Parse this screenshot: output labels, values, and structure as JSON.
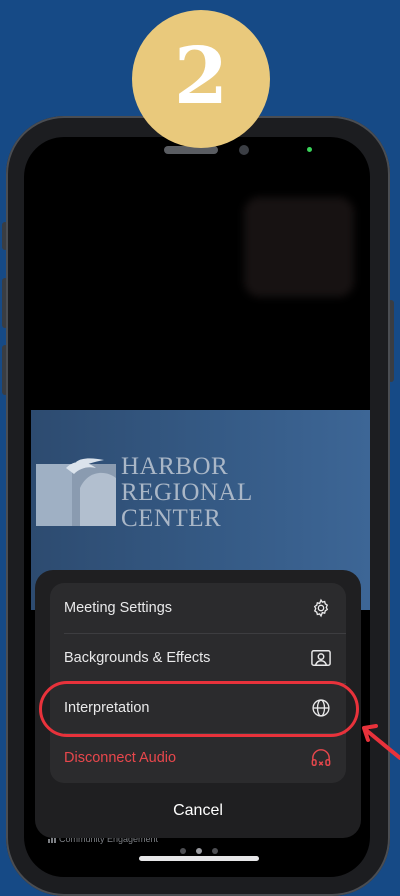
{
  "step": {
    "number": "2"
  },
  "background": {
    "brand": "Harbor Regional Center",
    "name_lines": [
      "HARBOR",
      "REGIONAL",
      "CENTER"
    ]
  },
  "video_footer": {
    "label": "Community Engagement"
  },
  "menu": {
    "items": [
      {
        "label": "Meeting Settings",
        "icon": "gear-icon"
      },
      {
        "label": "Backgrounds & Effects",
        "icon": "portrait-icon"
      },
      {
        "label": "Interpretation",
        "icon": "globe-icon",
        "highlighted": true
      },
      {
        "label": "Disconnect Audio",
        "icon": "headphones-off-icon",
        "danger": true
      }
    ],
    "cancel_label": "Cancel"
  },
  "colors": {
    "page_bg": "#164a86",
    "badge": "#e9c97c",
    "danger": "#e8474c",
    "highlight": "#e8323b"
  }
}
